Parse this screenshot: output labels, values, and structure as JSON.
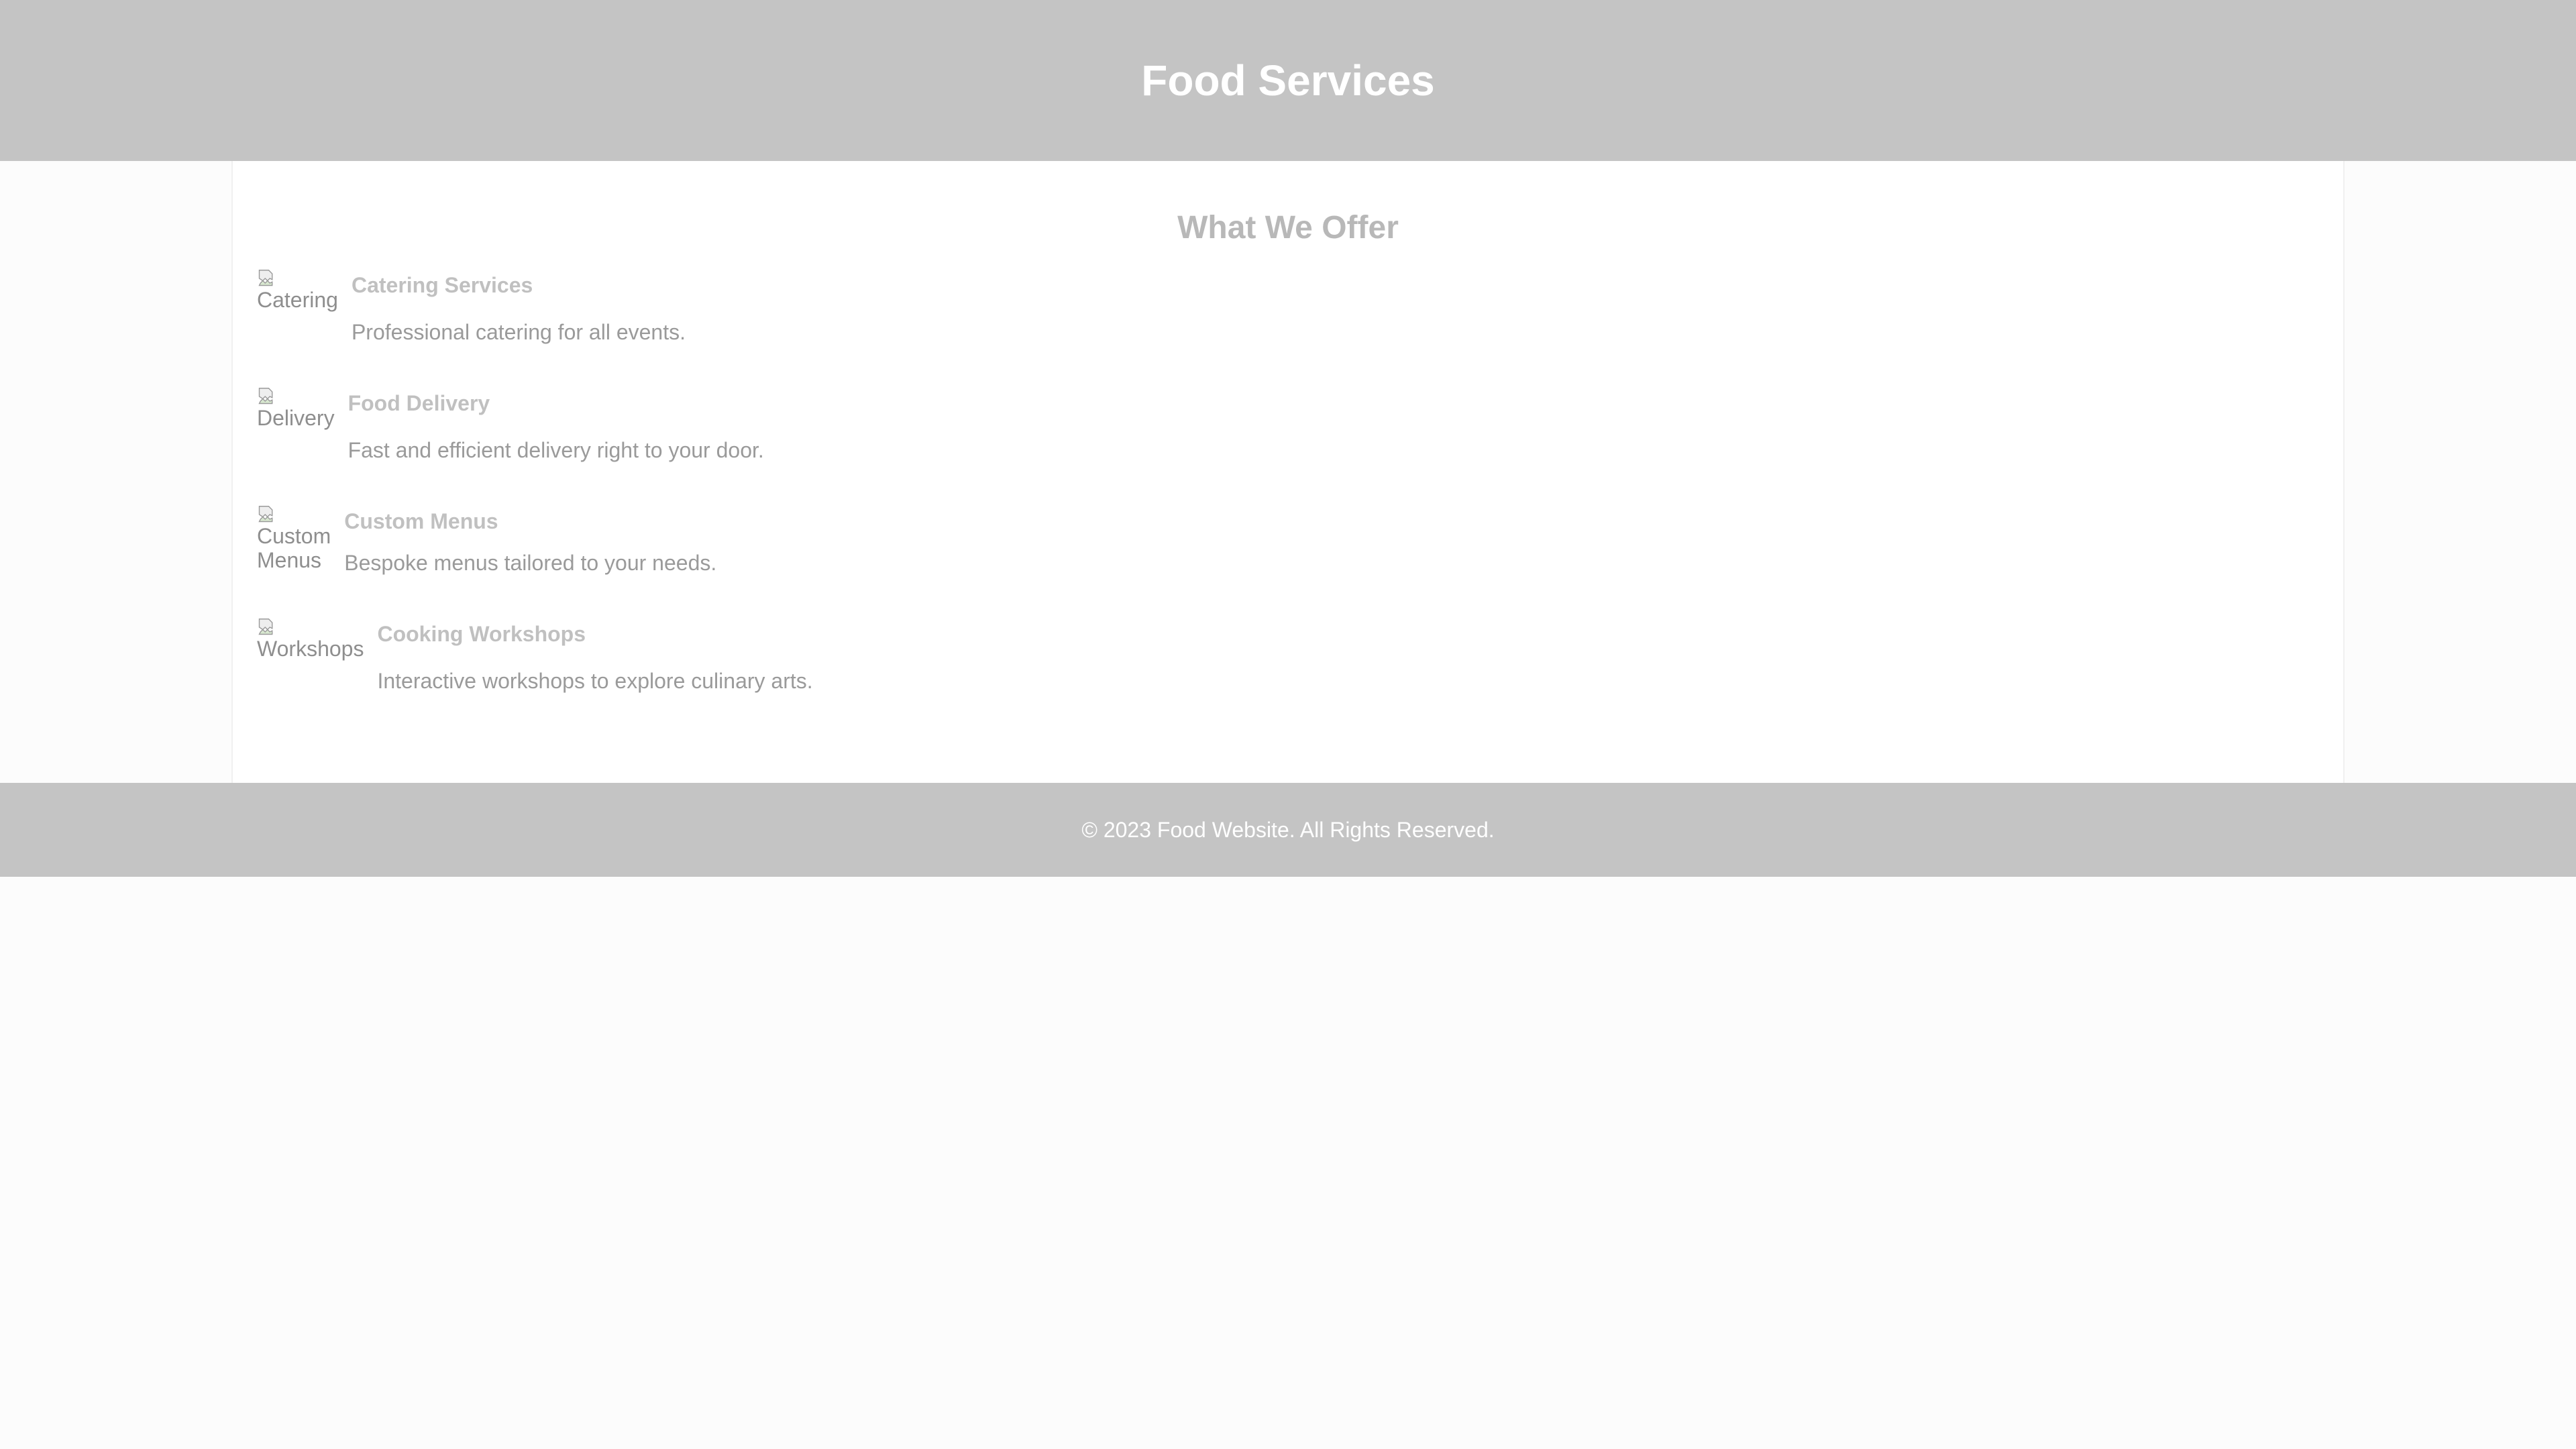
{
  "header": {
    "title": "Food Services"
  },
  "main": {
    "section_title": "What We Offer",
    "services": [
      {
        "image_alt": "Catering",
        "image_alt_lines": [
          "Catering"
        ],
        "name": "Catering Services",
        "description": "Professional catering for all events."
      },
      {
        "image_alt": "Delivery",
        "image_alt_lines": [
          "Delivery"
        ],
        "name": "Food Delivery",
        "description": "Fast and efficient delivery right to your door."
      },
      {
        "image_alt": "Custom Menus",
        "image_alt_lines": [
          "Custom",
          "Menus"
        ],
        "name": "Custom Menus",
        "description": "Bespoke menus tailored to your needs."
      },
      {
        "image_alt": "Workshops",
        "image_alt_lines": [
          "Workshops"
        ],
        "name": "Cooking Workshops",
        "description": "Interactive workshops to explore culinary arts."
      }
    ]
  },
  "footer": {
    "copyright": "© 2023 Food Website. All Rights Reserved."
  },
  "colors": {
    "header_bg": "#c4c4c4",
    "footer_bg": "#c4c4c4",
    "page_bg": "#fcfcfc",
    "content_bg": "#ffffff"
  }
}
